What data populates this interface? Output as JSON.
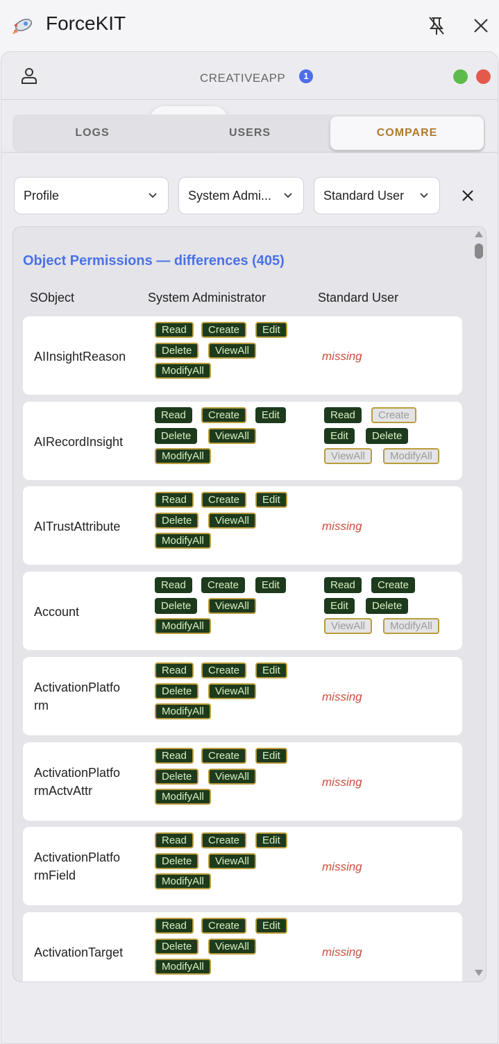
{
  "app": {
    "title": "ForceKIT"
  },
  "org": {
    "name": "CREATIVEAPP",
    "badge": "1",
    "status_colors": [
      "#5dbb4a",
      "#e35a4d"
    ]
  },
  "icon_tabs": [
    {
      "icon": "database-icon",
      "active": false
    },
    {
      "icon": "shield-icon",
      "active": true
    },
    {
      "icon": "key-icon",
      "active": false
    },
    {
      "icon": "settings-icon",
      "active": false
    }
  ],
  "tabs": [
    {
      "label": "LOGS",
      "active": false
    },
    {
      "label": "USERS",
      "active": false
    },
    {
      "label": "COMPARE",
      "active": true
    }
  ],
  "filters": {
    "type": "Profile",
    "left": "System Admi...",
    "right": "Standard User"
  },
  "results": {
    "title": "Object Permissions — differences (405)",
    "columns": [
      "SObject",
      "System Administrator",
      "Standard User"
    ],
    "missing_label": "missing",
    "rows": [
      {
        "object": "AIInsightReason",
        "object_lines": [
          "AIInsightReason"
        ],
        "left": [
          [
            "Read",
            1,
            1
          ],
          [
            "Create",
            1,
            1
          ],
          [
            "Edit",
            1,
            1
          ],
          [
            "Delete",
            1,
            1
          ],
          [
            "ViewAll",
            1,
            1
          ],
          [
            "ModifyAll",
            1,
            1
          ]
        ],
        "right": null
      },
      {
        "object": "AIRecordInsight",
        "object_lines": [
          "AIRecordInsight"
        ],
        "left": [
          [
            "Read",
            1,
            0
          ],
          [
            "Create",
            1,
            1
          ],
          [
            "Edit",
            1,
            0
          ],
          [
            "Delete",
            1,
            0
          ],
          [
            "ViewAll",
            1,
            1
          ],
          [
            "ModifyAll",
            1,
            1
          ]
        ],
        "right": [
          [
            "Read",
            1,
            0
          ],
          [
            "Create",
            0,
            1
          ],
          [
            "Edit",
            1,
            0
          ],
          [
            "Delete",
            1,
            0
          ],
          [
            "ViewAll",
            0,
            1
          ],
          [
            "ModifyAll",
            0,
            1
          ]
        ]
      },
      {
        "object": "AITrustAttribute",
        "object_lines": [
          "AITrustAttribute"
        ],
        "left": [
          [
            "Read",
            1,
            1
          ],
          [
            "Create",
            1,
            1
          ],
          [
            "Edit",
            1,
            1
          ],
          [
            "Delete",
            1,
            1
          ],
          [
            "ViewAll",
            1,
            1
          ],
          [
            "ModifyAll",
            1,
            1
          ]
        ],
        "right": null
      },
      {
        "object": "Account",
        "object_lines": [
          "Account"
        ],
        "left": [
          [
            "Read",
            1,
            0
          ],
          [
            "Create",
            1,
            0
          ],
          [
            "Edit",
            1,
            0
          ],
          [
            "Delete",
            1,
            0
          ],
          [
            "ViewAll",
            1,
            1
          ],
          [
            "ModifyAll",
            1,
            1
          ]
        ],
        "right": [
          [
            "Read",
            1,
            0
          ],
          [
            "Create",
            1,
            0
          ],
          [
            "Edit",
            1,
            0
          ],
          [
            "Delete",
            1,
            0
          ],
          [
            "ViewAll",
            0,
            1
          ],
          [
            "ModifyAll",
            0,
            1
          ]
        ]
      },
      {
        "object": "ActivationPlatform",
        "object_lines": [
          "ActivationPlatfo",
          "rm"
        ],
        "left": [
          [
            "Read",
            1,
            1
          ],
          [
            "Create",
            1,
            1
          ],
          [
            "Edit",
            1,
            1
          ],
          [
            "Delete",
            1,
            1
          ],
          [
            "ViewAll",
            1,
            1
          ],
          [
            "ModifyAll",
            1,
            1
          ]
        ],
        "right": null
      },
      {
        "object": "ActivationPlatformActvAttr",
        "object_lines": [
          "ActivationPlatfo",
          "rmActvAttr"
        ],
        "left": [
          [
            "Read",
            1,
            1
          ],
          [
            "Create",
            1,
            1
          ],
          [
            "Edit",
            1,
            1
          ],
          [
            "Delete",
            1,
            1
          ],
          [
            "ViewAll",
            1,
            1
          ],
          [
            "ModifyAll",
            1,
            1
          ]
        ],
        "right": null
      },
      {
        "object": "ActivationPlatformField",
        "object_lines": [
          "ActivationPlatfo",
          "rmField"
        ],
        "left": [
          [
            "Read",
            1,
            1
          ],
          [
            "Create",
            1,
            1
          ],
          [
            "Edit",
            1,
            1
          ],
          [
            "Delete",
            1,
            1
          ],
          [
            "ViewAll",
            1,
            1
          ],
          [
            "ModifyAll",
            1,
            1
          ]
        ],
        "right": null
      },
      {
        "object": "ActivationTarget",
        "object_lines": [
          "ActivationTarget"
        ],
        "left": [
          [
            "Read",
            1,
            1
          ],
          [
            "Create",
            1,
            1
          ],
          [
            "Edit",
            1,
            1
          ],
          [
            "Delete",
            1,
            1
          ],
          [
            "ViewAll",
            1,
            1
          ],
          [
            "ModifyAll",
            1,
            1
          ]
        ],
        "right": null
      }
    ]
  }
}
